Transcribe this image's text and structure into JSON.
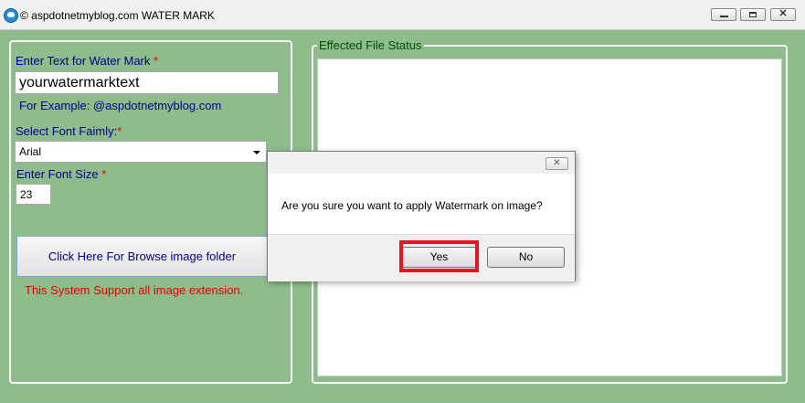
{
  "window": {
    "title": "© aspdotnetmyblog.com WATER MARK",
    "buttons": {
      "minimize": "—",
      "maximize": "▭",
      "close": "✕"
    }
  },
  "form": {
    "watermark_label": "Enter Text for Water Mark",
    "watermark_value": "yourwatermarktext",
    "example": "For Example:  @aspdotnetmyblog.com",
    "font_label": "Select Font Faimly:",
    "font_value": "Arial",
    "size_label": "Enter Font Size",
    "size_value": "23",
    "browse_button": "Click Here For Browse image folder",
    "support_note": "This System Support all image extension.",
    "required_mark": "*"
  },
  "status_panel": {
    "title": "Effected File Status"
  },
  "dialog": {
    "message": "Are you sure you want to apply Watermark on image?",
    "yes": "Yes",
    "no": "No",
    "close": "✕"
  },
  "colors": {
    "background": "#8fbc8b",
    "label_text": "#00008b",
    "required": "#e00000",
    "highlight": "#e8161c"
  }
}
